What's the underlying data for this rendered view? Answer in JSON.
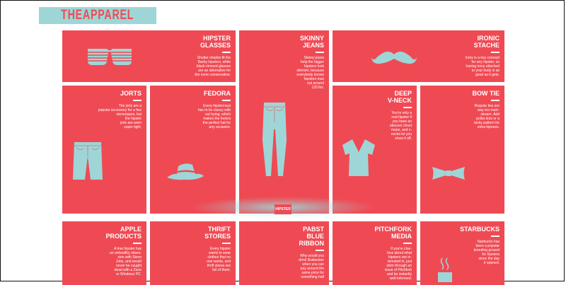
{
  "header": {
    "title": "THEAPPAREL"
  },
  "separator": {
    "label": "HIPSTER"
  },
  "colors": {
    "card": "#ef4a54",
    "accent": "#9ed6d7",
    "text": "#ffffff"
  },
  "cards": {
    "hipster_glasses": {
      "title_1": "HIPSTER",
      "title_2": "GLASSES",
      "desc": [
        "Shutter shades fit the",
        "flashy hipsters, while",
        "black rimmed glasses",
        "are an alternative for",
        "the more conservative."
      ],
      "icon": "shutter-shades"
    },
    "skinny_jeans": {
      "title_1": "SKINNY",
      "title_2": "JEANS",
      "desc": [
        "Skinny jeans",
        "help the bigger",
        "hipsters look",
        "skinnier, because",
        "everybody knows",
        "hipsters max",
        "out around",
        "120 lbs."
      ],
      "icon": "jeans"
    },
    "ironic_stache": {
      "title_1": "IRONIC",
      "title_2": "STACHE",
      "desc": [
        "Irony is a key concept",
        "for any hipster, so",
        "having irony attached",
        "to your body is as",
        "good as it gets."
      ],
      "icon": "mustache"
    },
    "jorts": {
      "title_1": "JORTS",
      "desc": [
        "The jorts are a",
        "popular accessory for a few",
        "stereotypes, but",
        "the hipster",
        "jorts are worn",
        "super tight."
      ],
      "icon": "jorts"
    },
    "fedora": {
      "title_1": "FEDORA",
      "desc": [
        "Every hipsternaut",
        "has to be classy with",
        "out trying, which",
        "makes the fedora",
        "the perfect hat for",
        "any occasion."
      ],
      "icon": "fedora"
    },
    "deep_vneck": {
      "title_1": "DEEP",
      "title_2": "V-NECK",
      "desc": [
        "You're only a",
        "real hipster if",
        "you have an",
        "obscure chest",
        "mane, and v-",
        "necks let you",
        "show it off."
      ],
      "icon": "v-neck-shirt"
    },
    "bow_tie": {
      "title_1": "BOW TIE",
      "desc": [
        "Regular ties are",
        "way too main-",
        "stream. Add",
        "polka dots or a",
        "tacky pattern for",
        "extra hipness."
      ],
      "icon": "bow-tie"
    },
    "apple_products": {
      "title_1": "APPLE",
      "title_2": "PRODUCTS",
      "desc": [
        "A true hipster has",
        "an unhealthy obses-",
        "sion with Steve",
        "Jobs, and would",
        "never be caught",
        "dead with a Zune",
        "or Windows PC."
      ]
    },
    "thrift_stores": {
      "title_1": "THRIFT",
      "title_2": "STORES",
      "desc": [
        "Every hipster",
        "wants to wear",
        "clothes that no",
        "one wants, and",
        "thrift stores are",
        "full of them."
      ]
    },
    "pabst": {
      "title_1": "PABST",
      "title_2": "BLUE",
      "title_3": "RIBBON",
      "desc": [
        "Why would you",
        "drink Budweiser",
        "when you can",
        "pay around the",
        "same price for",
        "something half"
      ]
    },
    "pitchfork": {
      "title_1": "PITCHFORK",
      "title_2": "MEDIA",
      "desc": [
        "If you're clue-",
        "less about what",
        "hipsters are in-",
        "terested in, just",
        "skim through an",
        "issue of Pitchfork",
        "and be instantly",
        "well-informed."
      ]
    },
    "starbucks": {
      "title_1": "STARBUCKS",
      "desc": [
        "Starbucks has",
        "been a popular",
        "breeding ground",
        "for hipsters",
        "since the day",
        "it opened."
      ],
      "icon": "coffee-cup"
    }
  }
}
